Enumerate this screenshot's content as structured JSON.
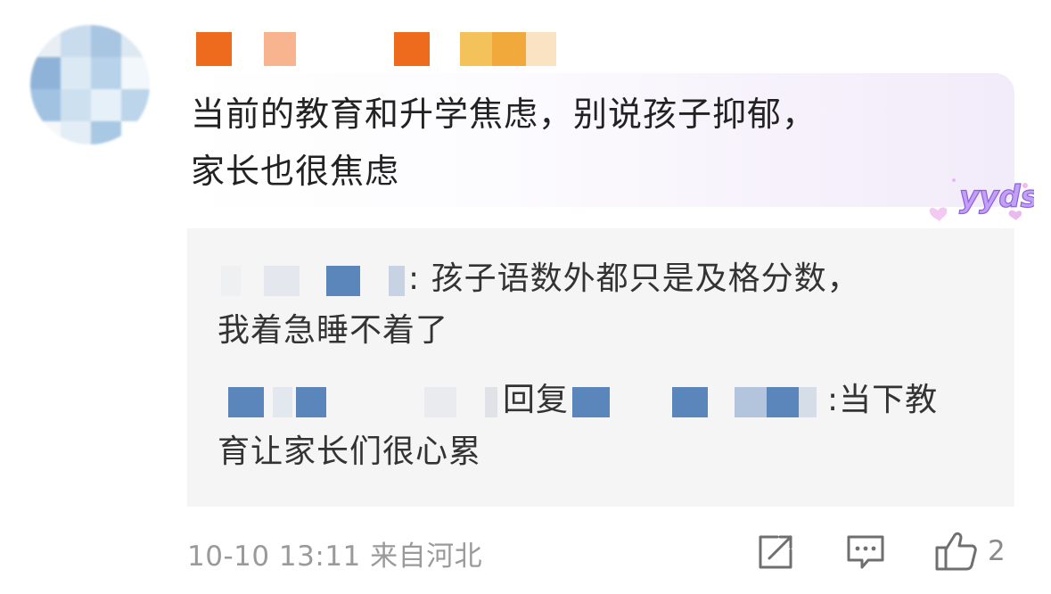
{
  "comment": {
    "line1": "当前的教育和升学焦虑，别说孩子抑郁，",
    "line2": "家长也很焦虑",
    "sticker_text": "yyds"
  },
  "replies": [
    {
      "separator": ":",
      "text_line1": " 孩子语数外都只是及格分数，",
      "text_line2": "我着急睡不着了"
    },
    {
      "reply_word": "回复",
      "separator": ":",
      "text_line1": "当下教",
      "text_line2": "育让家长们很心累"
    }
  ],
  "footer": {
    "timestamp": "10-10 13:11 来自河北",
    "like_count": "2"
  },
  "colors": {
    "reply_bg": "#f5f5f5",
    "mosaic_blue": "#5b86bb",
    "badge_orange": "#ee6a1c",
    "text": "#222222",
    "meta": "#9a9a9a"
  },
  "icons": {
    "share": "share-icon",
    "comment": "comment-icon",
    "like": "thumbs-up-icon"
  }
}
